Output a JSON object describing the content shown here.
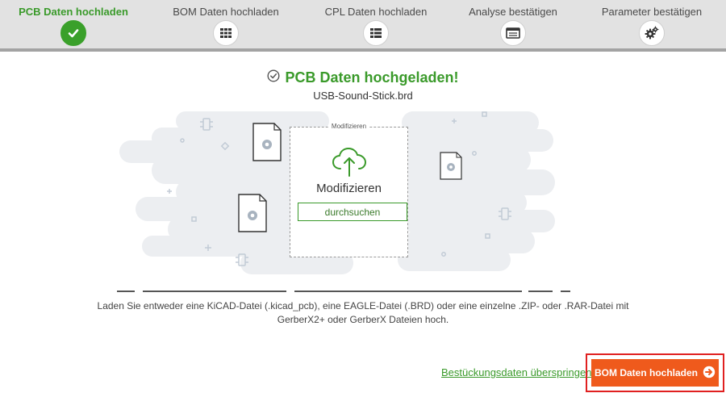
{
  "stepper": {
    "steps": [
      {
        "label": "PCB Daten hochladen",
        "icon": "check-icon",
        "active": true
      },
      {
        "label": "BOM Daten hochladen",
        "icon": "grid-icon",
        "active": false
      },
      {
        "label": "CPL Daten hochladen",
        "icon": "list-icon",
        "active": false
      },
      {
        "label": "Analyse bestätigen",
        "icon": "document-list-icon",
        "active": false
      },
      {
        "label": "Parameter bestätigen",
        "icon": "gears-icon",
        "active": false
      }
    ],
    "active_color": "#3aa02a"
  },
  "status": {
    "title": "PCB Daten hochgeladen!",
    "filename": "USB-Sound-Stick.brd"
  },
  "dropzone": {
    "legend": "Modifizieren",
    "label": "Modifizieren",
    "browse_label": "durchsuchen"
  },
  "info_lines": [
    "Laden Sie entweder eine KiCAD-Datei (.kicad_pcb), eine EAGLE-Datei (.BRD) oder eine einzelne .ZIP- oder .RAR-Datei mit",
    "GerberX2+ oder GerberX Dateien hoch."
  ],
  "actions": {
    "skip_label": "Bestückungsdaten überspringen",
    "next_label": "BOM Daten hochladen",
    "next_color": "#ef5a1c"
  }
}
